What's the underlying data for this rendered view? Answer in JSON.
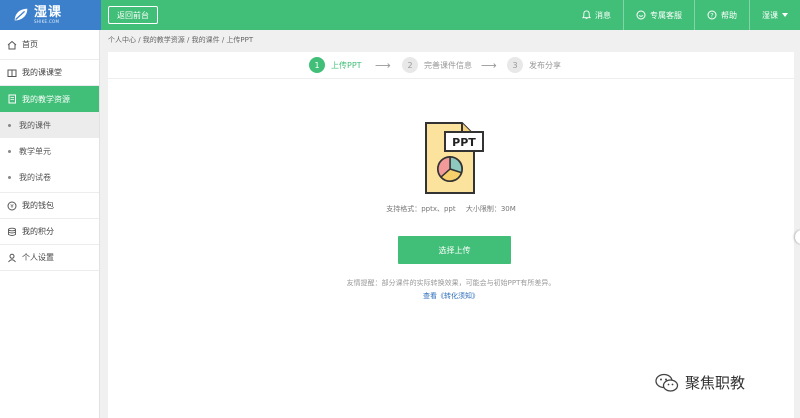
{
  "brand": {
    "name": "湿课",
    "tagline": "SHIKE.COM"
  },
  "topbar": {
    "back_label": "返回前台",
    "messages_label": "消息",
    "service_label": "专属客服",
    "help_label": "帮助",
    "user_label": "湿课"
  },
  "sidebar": {
    "home": "首页",
    "my_class": "我的课课堂",
    "teaching_resources": "我的教学资源",
    "sub_items": [
      "我的课件",
      "教学单元",
      "我的试卷"
    ],
    "wallet": "我的钱包",
    "points": "我的积分",
    "settings": "个人设置"
  },
  "breadcrumb": "个人中心 / 我的教学资源 / 我的课件 / 上传PPT",
  "steps": [
    {
      "num": "1",
      "label": "上传PPT"
    },
    {
      "num": "2",
      "label": "完善课件信息"
    },
    {
      "num": "3",
      "label": "发布分享"
    }
  ],
  "step_arrow": "⟶",
  "file_icon_text": "PPT",
  "support": {
    "formats": "支持格式：pptx、ppt",
    "size_limit": "大小限制：30M"
  },
  "upload_button": "选择上传",
  "hint": "友情提醒：部分课件的实际转换效果，可能会与初始PPT有所差异。",
  "hint_link": "查看《转化须知》",
  "watermark": "聚焦职教",
  "colors": {
    "green": "#41bf78",
    "blue": "#3c80cc",
    "link": "#2b6db8"
  }
}
